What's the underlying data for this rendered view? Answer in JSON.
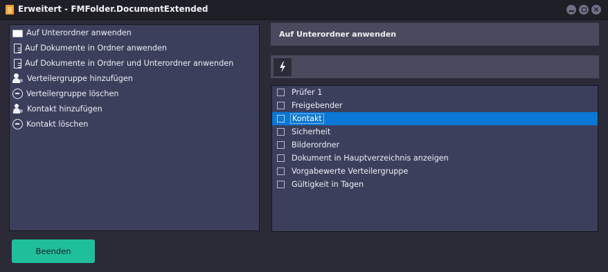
{
  "window": {
    "title": "Erweitert - FMFolder.DocumentExtended",
    "close_glyph": "×"
  },
  "left_list": {
    "items": [
      {
        "label": "Auf Unterordner anwenden",
        "icon": "folder-icon",
        "selected": true
      },
      {
        "label": "Auf Dokumente in Ordner anwenden",
        "icon": "document-icon",
        "selected": false
      },
      {
        "label": "Auf Dokumente in Ordner und Unterordner anwenden",
        "icon": "document-icon",
        "selected": false
      },
      {
        "label": "Verteilergruppe hinzufügen",
        "icon": "add-group-icon",
        "selected": false
      },
      {
        "label": "Verteilergruppe löschen",
        "icon": "remove-icon",
        "selected": false
      },
      {
        "label": "Kontakt hinzufügen",
        "icon": "add-contact-icon",
        "selected": false
      },
      {
        "label": "Kontakt löschen",
        "icon": "remove-icon",
        "selected": false
      }
    ]
  },
  "detail": {
    "header": "Auf Unterordner anwenden",
    "action_icon": "lightning-icon"
  },
  "fields": {
    "items": [
      {
        "label": "Prüfer 1",
        "checked": false,
        "selected": false
      },
      {
        "label": "Freigebender",
        "checked": false,
        "selected": false
      },
      {
        "label": "Kontakt",
        "checked": false,
        "selected": true
      },
      {
        "label": "Sicherheit",
        "checked": false,
        "selected": false
      },
      {
        "label": "Bilderordner",
        "checked": false,
        "selected": false
      },
      {
        "label": "Dokument in Hauptverzeichnis anzeigen",
        "checked": false,
        "selected": false
      },
      {
        "label": "Vorgabewerte Verteilergruppe",
        "checked": false,
        "selected": false
      },
      {
        "label": "Gültigkeit in Tagen",
        "checked": false,
        "selected": false
      }
    ]
  },
  "footer": {
    "finish_label": "Beenden"
  },
  "colors": {
    "accent": "#20bf9b",
    "selection": "#0a78d4",
    "panel": "#3b3f5c",
    "background": "#2b2b38"
  }
}
